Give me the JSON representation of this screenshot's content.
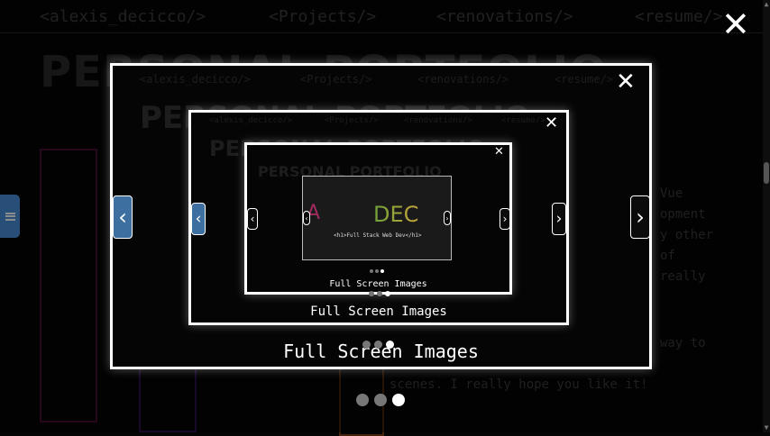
{
  "nav": {
    "home": "<alexis_decicco/>",
    "projects": "<Projects/>",
    "renovations": "<renovations/>",
    "resume": "<resume/>"
  },
  "page_title": "PERSONAL PORTFOLIO",
  "bg_lines": [
    "Vue",
    "opment",
    "y other",
    "of",
    "really",
    "way to",
    "scenes. I really hope you like it!"
  ],
  "lightbox": {
    "caption": "Full Screen Images",
    "prev_label": "‹",
    "next_label": "›",
    "close_label": "✕",
    "slide_count": 3,
    "active_slide": 3,
    "slide_title_left": "A",
    "slide_title_right": "DEC",
    "slide_tag": "<h1>Full Stack Web Dev</h1>"
  },
  "colors": {
    "accent": "#4a90d9",
    "frame": "#ffffff",
    "dot_active": "#ffffff",
    "dot_inactive": "#777777"
  }
}
